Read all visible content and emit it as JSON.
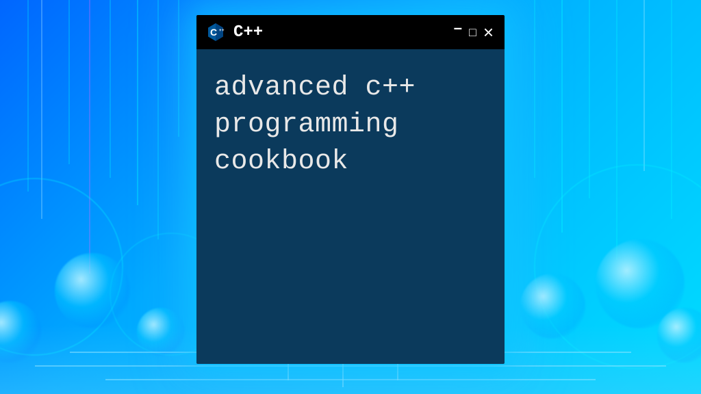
{
  "window": {
    "title": "C++",
    "icon_label": "C++",
    "content": "advanced c++ programming cookbook",
    "controls": {
      "minimize": "–",
      "maximize": "□",
      "close": "×"
    }
  },
  "colors": {
    "titlebar_bg": "#000000",
    "body_bg": "#0b3a5c",
    "text": "#e8e8e8",
    "bg_gradient_start": "#0066ff",
    "bg_gradient_end": "#00ddff"
  }
}
